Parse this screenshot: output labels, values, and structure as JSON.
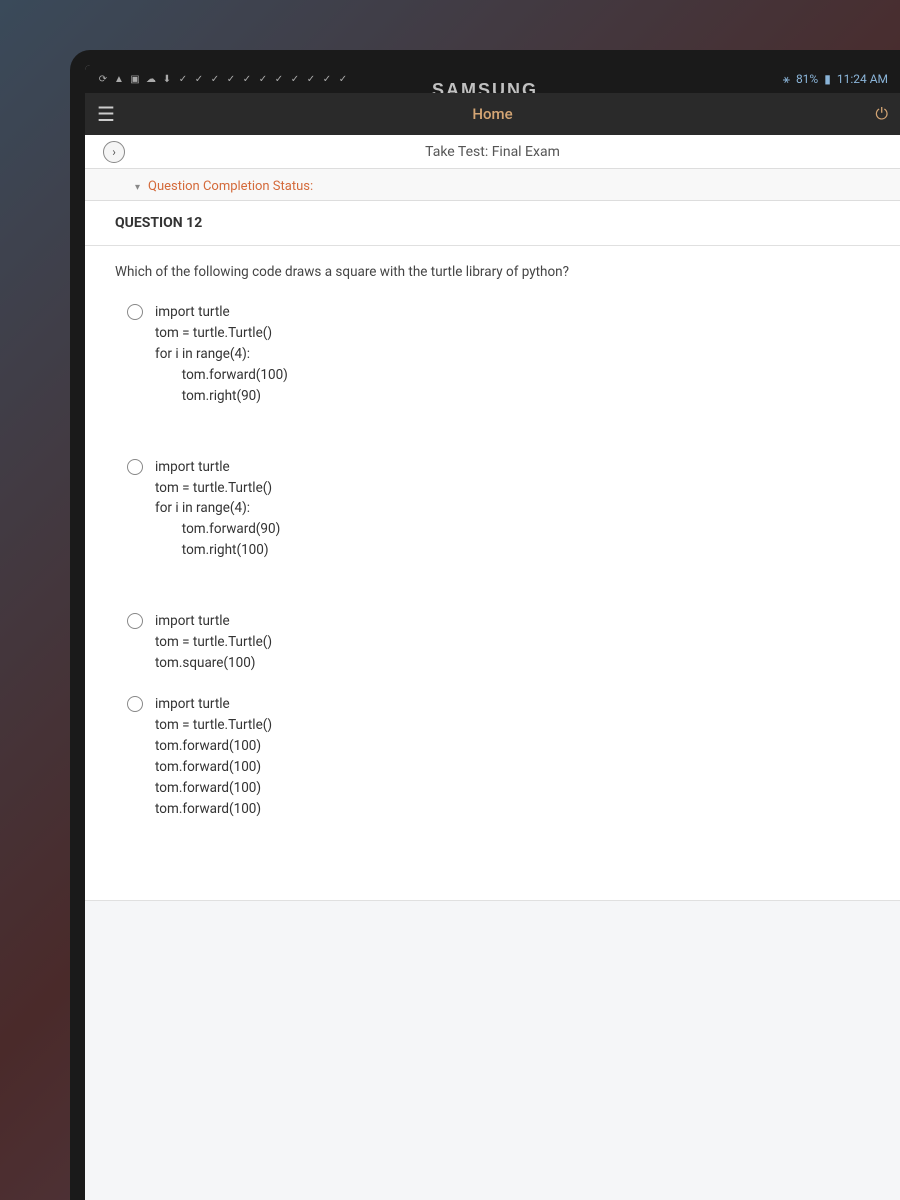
{
  "device": {
    "brand": "SAMSUNG"
  },
  "statusBar": {
    "battery": "81%",
    "time": "11:24 AM"
  },
  "appHeader": {
    "title": "Home"
  },
  "subtitle": "Take Test: Final Exam",
  "completion": {
    "label": "Question Completion Status:"
  },
  "question": {
    "header": "QUESTION 12",
    "prompt": "Which of the following code draws a square with the turtle library of python?",
    "options": {
      "a": "import turtle\ntom = turtle.Turtle()\nfor i in range(4):\n        tom.forward(100)\n        tom.right(90)",
      "b": "import turtle\ntom = turtle.Turtle()\nfor i in range(4):\n        tom.forward(90)\n        tom.right(100)",
      "c": "import turtle\ntom = turtle.Turtle()\ntom.square(100)",
      "d": "import turtle\ntom = turtle.Turtle()\ntom.forward(100)\ntom.forward(100)\ntom.forward(100)\ntom.forward(100)"
    }
  }
}
